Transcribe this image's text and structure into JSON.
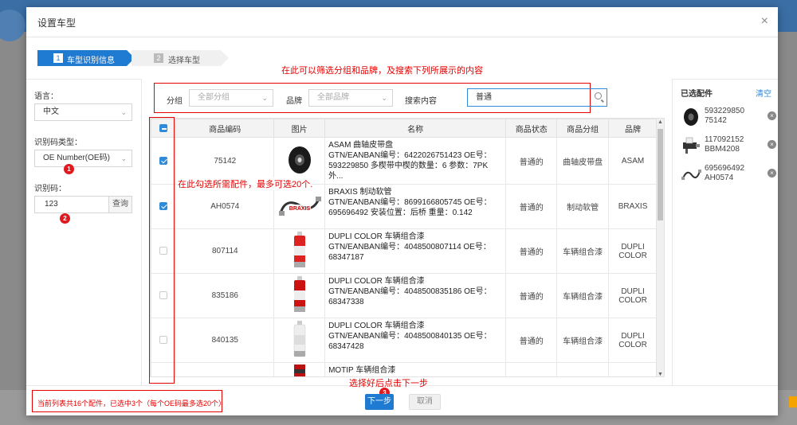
{
  "modal": {
    "title": "设置车型",
    "close": "×"
  },
  "steps": [
    {
      "num": "1",
      "label": "车型识别信息"
    },
    {
      "num": "2",
      "label": "选择车型"
    }
  ],
  "annotations": {
    "filter_note": "在此可以筛选分组和品牌，及搜索下列所展示的内容",
    "check_note": "在此勾选所需配件，最多可选20个.",
    "next_note": "选择好后点击下一步",
    "badge1": "1",
    "badge2": "2",
    "badge3": "3"
  },
  "left": {
    "language_label": "语言：",
    "language_value": "中文",
    "code_type_label": "识别码类型：",
    "code_type_value": "OE Number(OE码)",
    "code_label": "识别码：",
    "code_value": "123",
    "query_button": "查询"
  },
  "filters": {
    "group_label": "分组",
    "group_value": "全部分组",
    "brand_label": "品牌",
    "brand_value": "全部品牌",
    "search_label": "搜索内容",
    "search_value": "普通"
  },
  "table": {
    "columns": [
      "商品编码",
      "图片",
      "名称",
      "商品状态",
      "商品分组",
      "品牌"
    ],
    "rows": [
      {
        "checked": true,
        "code": "75142",
        "name_title": "ASAM 曲轴皮带盘",
        "name_detail": "GTN/EANBAN编号：6422026751423 OE号：593229850 多楔带中楔的数量：6 参数：7PK 外...",
        "status": "普通的",
        "group": "曲轴皮带盘",
        "brand": "ASAM"
      },
      {
        "checked": true,
        "code": "AH0574",
        "name_title": "BRAXIS 制动软管",
        "name_detail": "GTN/EANBAN编号：8699166805745 OE号：695696492 安装位置：后桥 重量：0.142",
        "status": "普通的",
        "group": "制动软管",
        "brand": "BRAXIS"
      },
      {
        "checked": false,
        "code": "807114",
        "name_title": "DUPLI COLOR 车辆组合漆",
        "name_detail": "GTN/EANBAN编号：4048500807114 OE号：68347187",
        "status": "普通的",
        "group": "车辆组合漆",
        "brand": "DUPLI COLOR"
      },
      {
        "checked": false,
        "code": "835186",
        "name_title": "DUPLI COLOR 车辆组合漆",
        "name_detail": "GTN/EANBAN编号：4048500835186 OE号：68347338",
        "status": "普通的",
        "group": "车辆组合漆",
        "brand": "DUPLI COLOR"
      },
      {
        "checked": false,
        "code": "840135",
        "name_title": "DUPLI COLOR 车辆组合漆",
        "name_detail": "GTN/EANBAN编号：4048500840135 OE号：68347428",
        "status": "普通的",
        "group": "车辆组合漆",
        "brand": "DUPLI COLOR"
      },
      {
        "checked": false,
        "code": "",
        "name_title": "MOTIP 车辆组合漆",
        "name_detail": "",
        "status": "",
        "group": "",
        "brand": ""
      }
    ]
  },
  "selected": {
    "title": "已选配件",
    "clear": "清空",
    "items": [
      {
        "line1": "593229850",
        "line2": "75142"
      },
      {
        "line1": "117092152",
        "line2": "BBM4208"
      },
      {
        "line1": "695696492",
        "line2": "AH0574"
      }
    ]
  },
  "footer": {
    "note": "当前列表共16个配件，已选中3个（每个OE码最多选20个）",
    "next": "下一步",
    "cancel": "取消"
  }
}
